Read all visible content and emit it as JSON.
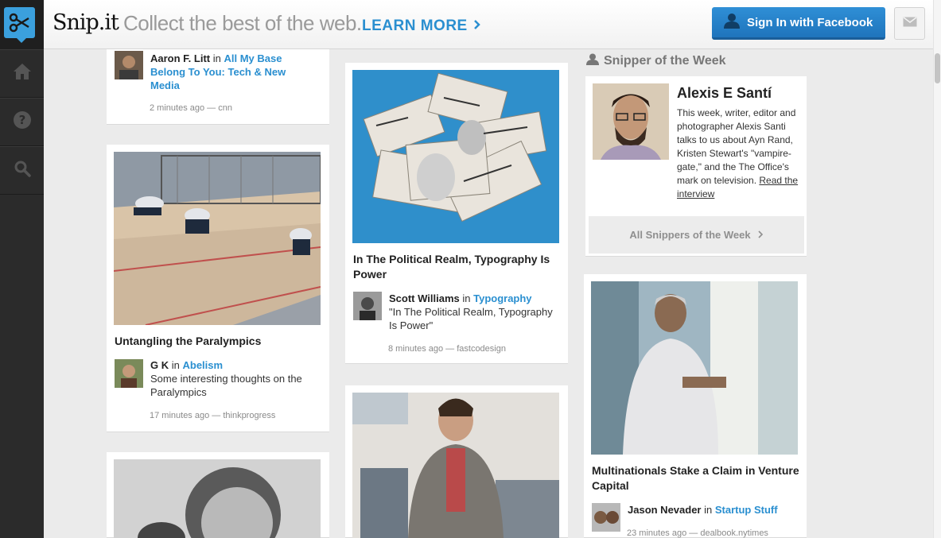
{
  "app": {
    "brand": "Snip.it",
    "tagline": "Collect the best of the web.",
    "learn_more": "LEARN MORE",
    "facebook_button": "Sign In with Facebook",
    "accent_color": "#2a8fd0"
  },
  "nav": {
    "items": [
      {
        "icon": "scissors-icon"
      },
      {
        "icon": "home-icon"
      },
      {
        "icon": "help-icon"
      },
      {
        "icon": "search-icon"
      }
    ]
  },
  "feed": {
    "column1": [
      {
        "user": "Aaron F. Litt",
        "in": "in",
        "category": "All My Base Belong To You: Tech & New Media",
        "time": "2 minutes ago — cnn"
      },
      {
        "title": "Untangling the Paralympics",
        "user": "G K",
        "in": "in",
        "category": "Abelism",
        "quote": "Some interesting thoughts on the Paralympics",
        "time": "17 minutes ago — thinkprogress"
      }
    ],
    "column2": [
      {
        "title": "In The Political Realm, Typography Is Power",
        "user": "Scott Williams",
        "in": "in",
        "category": "Typography",
        "quote": "\"In The Political Realm, Typography Is Power\"",
        "time": "8 minutes ago — fastcodesign"
      }
    ],
    "column3": [
      {
        "title": "Multinationals Stake a Claim in Venture Capital",
        "user": "Jason Nevader",
        "in": "in",
        "category": "Startup Stuff",
        "time": "23 minutes ago — dealbook.nytimes"
      }
    ]
  },
  "sotw": {
    "heading": "Snipper of the Week",
    "name": "Alexis E Santí",
    "bio": "This week, writer, editor and photographer Alexis Santi talks to us about Ayn Rand, Kristen Stewart's \"vampire-gate,\" and the The Office's mark on television.",
    "read_link": "Read the interview",
    "all_link": "All Snippers of the Week"
  }
}
